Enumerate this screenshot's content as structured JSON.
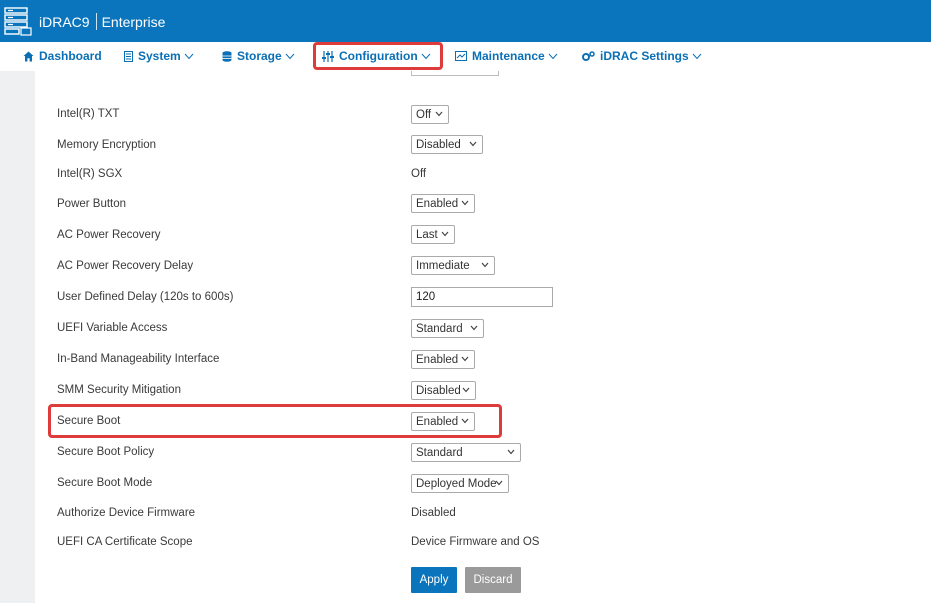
{
  "header": {
    "product": "iDRAC9",
    "edition": "Enterprise"
  },
  "nav": {
    "dashboard": "Dashboard",
    "system": "System",
    "storage": "Storage",
    "configuration": "Configuration",
    "maintenance": "Maintenance",
    "idrac_settings": "iDRAC Settings"
  },
  "settings": [
    {
      "label": "Intel(R) TXT",
      "type": "select",
      "value": "Off"
    },
    {
      "label": "Memory Encryption",
      "type": "select",
      "value": "Disabled"
    },
    {
      "label": "Intel(R) SGX",
      "type": "text",
      "value": "Off"
    },
    {
      "label": "Power Button",
      "type": "select",
      "value": "Enabled"
    },
    {
      "label": "AC Power Recovery",
      "type": "select",
      "value": "Last"
    },
    {
      "label": "AC Power Recovery Delay",
      "type": "select",
      "value": "Immediate"
    },
    {
      "label": "User Defined Delay (120s to 600s)",
      "type": "input",
      "value": "120"
    },
    {
      "label": "UEFI Variable Access",
      "type": "select",
      "value": "Standard"
    },
    {
      "label": "In-Band Manageability Interface",
      "type": "select",
      "value": "Enabled"
    },
    {
      "label": "SMM Security Mitigation",
      "type": "select",
      "value": "Disabled"
    },
    {
      "label": "Secure Boot",
      "type": "select",
      "value": "Enabled"
    },
    {
      "label": "Secure Boot Policy",
      "type": "select",
      "value": "Standard"
    },
    {
      "label": "Secure Boot Mode",
      "type": "select",
      "value": "Deployed Mode"
    },
    {
      "label": "Authorize Device Firmware",
      "type": "text",
      "value": "Disabled"
    },
    {
      "label": "UEFI CA Certificate Scope",
      "type": "text",
      "value": "Device Firmware and OS"
    }
  ],
  "actions": {
    "apply": "Apply",
    "discard": "Discard"
  },
  "colors": {
    "header_bg": "#0a75bd",
    "nav_text": "#0a6fb4",
    "highlight": "#de3b3b",
    "apply_bg": "#0a75bd",
    "discard_bg": "#9a9a9a"
  }
}
